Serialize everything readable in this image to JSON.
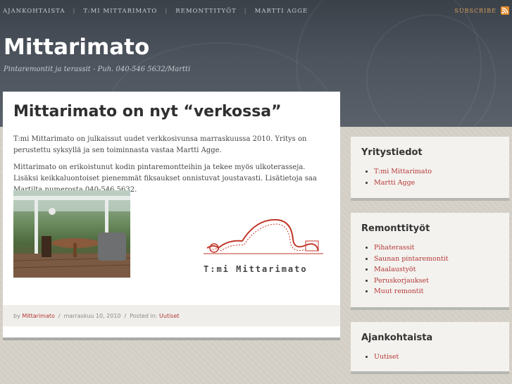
{
  "nav": {
    "items": [
      "AJANKOHTAISTA",
      "T:MI MITTARIMATO",
      "REMONTTITYÖT",
      "MARTTI AGGE"
    ],
    "separator": "|",
    "subscribe": "SUBSCRIBE",
    "rss_icon": "rss-icon"
  },
  "site": {
    "title": "Mittarimato",
    "tagline": "Pintaremontit ja terassit - Puh. 040-546 5632/Martti"
  },
  "post": {
    "title": "Mittarimato on nyt “verkossa”",
    "paragraphs": [
      "T:mi Mittarimato on julkaissut uudet verkkosivunsa marraskuussa 2010. Yritys on perustettu syksyllä ja sen toiminnasta vastaa Martti Agge.",
      "Mittarimato on erikoistunut kodin pintaremontteihin ja tekee myös ulkoterasseja. Lisäksi keikkaluontoiset pienemmät fiksaukset onnistuvat joustavasti. Lisätietoja saa Martilta numerosta 040-546 5632."
    ],
    "logo_text": "T:mi Mittarimato",
    "meta": {
      "by": "by",
      "author": "Mittarimato",
      "date": "marraskuu 10, 2010",
      "posted_in": "Posted in:",
      "category": "Uutiset",
      "sep": "/"
    }
  },
  "sidebar": {
    "widgets": [
      {
        "title": "Yritystiedot",
        "items": [
          "T:mi Mittarimato",
          "Martti Agge"
        ]
      },
      {
        "title": "Remonttityöt",
        "items": [
          "Pihaterassit",
          "Saunan pintaremontit",
          "Maalaustyöt",
          "Peruskorjaukset",
          "Muut remontit"
        ]
      },
      {
        "title": "Ajankohtaista",
        "items": [
          "Uutiset"
        ]
      }
    ]
  },
  "colors": {
    "link": "#b43737",
    "header": "#4c535d",
    "subscribe": "#d9a05a"
  }
}
